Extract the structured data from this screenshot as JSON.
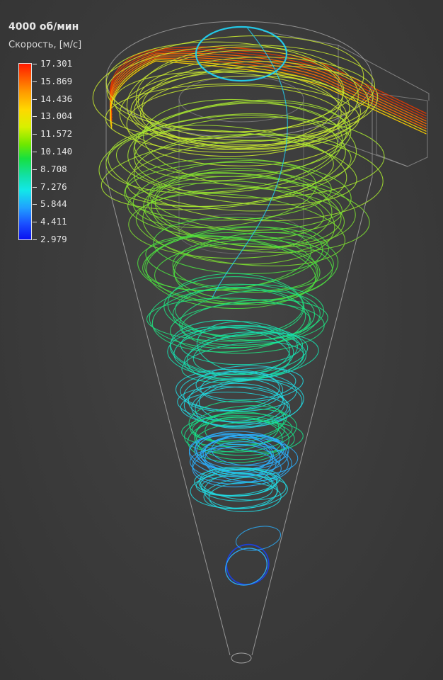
{
  "legend": {
    "title": "4000 об/мин",
    "subtitle": "Скорость, [м/с]",
    "ticks": [
      "17.301",
      "15.869",
      "14.436",
      "13.004",
      "11.572",
      "10.140",
      "8.708",
      "7.276",
      "5.844",
      "4.411",
      "2.979"
    ],
    "colormap": [
      "#ff1a00",
      "#ff5a00",
      "#ff9a00",
      "#ffd800",
      "#d8f000",
      "#6ee800",
      "#16e040",
      "#12e0a8",
      "#12e8e8",
      "#20a0ff",
      "#1a50ff",
      "#0a10f0"
    ]
  },
  "colors": {
    "background": "#3c3c3c",
    "geometry_wire": "#b4b4b4",
    "inlet_stream": "#ff6a00",
    "inlet_stream_fast": "#e83a00",
    "top_spiral": "#c8e830",
    "upper_spiral": "#7ee030",
    "mid_spiral": "#20e080",
    "lower_spiral": "#22d8e0",
    "core_spiral": "#2ab0ff",
    "slow_loop": "#1a40e0",
    "vortex_finder_loop": "#22d0f0"
  }
}
